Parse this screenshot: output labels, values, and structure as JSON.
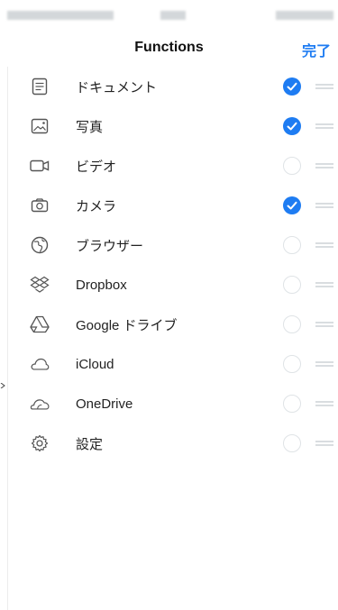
{
  "nav": {
    "title": "Functions",
    "done": "完了"
  },
  "colors": {
    "accent": "#1e7cf2",
    "divider": "#ececec"
  },
  "items": [
    {
      "label": "ドキュメント",
      "icon": "document-icon",
      "checked": true
    },
    {
      "label": "写真",
      "icon": "photo-icon",
      "checked": true
    },
    {
      "label": "ビデオ",
      "icon": "video-icon",
      "checked": false
    },
    {
      "label": "カメラ",
      "icon": "camera-icon",
      "checked": true
    },
    {
      "label": "ブラウザー",
      "icon": "globe-icon",
      "checked": false
    },
    {
      "label": "Dropbox",
      "icon": "dropbox-icon",
      "checked": false
    },
    {
      "label": "Google ドライブ",
      "icon": "google-drive-icon",
      "checked": false
    },
    {
      "label": "iCloud",
      "icon": "icloud-icon",
      "checked": false
    },
    {
      "label": "OneDrive",
      "icon": "onedrive-icon",
      "checked": false
    },
    {
      "label": "設定",
      "icon": "settings-gear-icon",
      "checked": false
    }
  ]
}
